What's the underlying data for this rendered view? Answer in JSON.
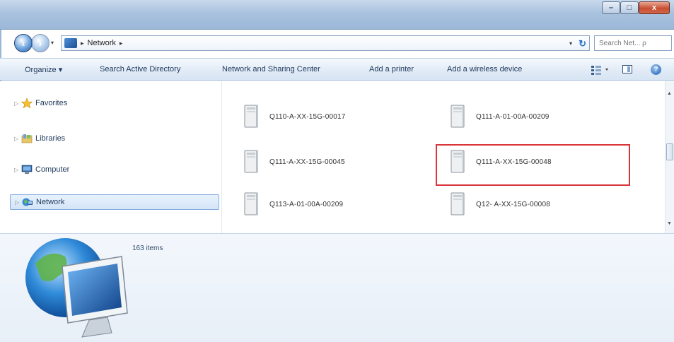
{
  "window": {
    "controls": {
      "minimize": "–",
      "maximize": "□",
      "close": "x"
    }
  },
  "address": {
    "path": [
      "Network"
    ],
    "search_placeholder": "Search Net... ρ"
  },
  "toolbar": {
    "organize": "Organize ▾",
    "search_ad": "Search Active Directory",
    "network_sharing": "Network and Sharing Center",
    "add_printer": "Add a printer",
    "add_wireless": "Add a wireless device"
  },
  "nav": {
    "items": [
      {
        "label": "Favorites",
        "icon": "star-icon"
      },
      {
        "label": "Libraries",
        "icon": "libraries-icon"
      },
      {
        "label": "Computer",
        "icon": "computer-icon"
      },
      {
        "label": "Network",
        "icon": "network-icon",
        "selected": true
      }
    ]
  },
  "content": {
    "computers": [
      "Q110-A-XX-15G-00017",
      "Q111-A-01-00A-00209",
      "Q111-A-XX-15G-00045",
      "Q111-A-XX-15G-00048",
      "Q113-A-01-00A-00209",
      "Q12- A-XX-15G-00008"
    ],
    "highlighted_index": 3
  },
  "details": {
    "item_count": "163 items"
  }
}
